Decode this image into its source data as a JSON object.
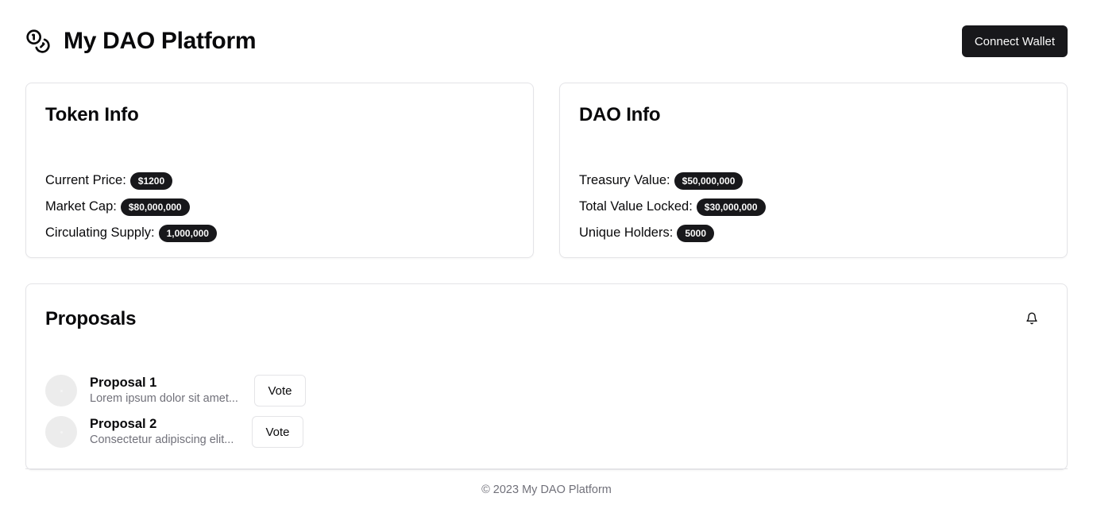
{
  "header": {
    "title": "My DAO Platform",
    "logo_icon": "coins-icon",
    "connect_label": "Connect Wallet"
  },
  "token_info": {
    "title": "Token Info",
    "stats": [
      {
        "label": "Current Price:",
        "value": "$1200"
      },
      {
        "label": "Market Cap:",
        "value": "$80,000,000"
      },
      {
        "label": "Circulating Supply:",
        "value": "1,000,000"
      }
    ]
  },
  "dao_info": {
    "title": "DAO Info",
    "stats": [
      {
        "label": "Treasury Value:",
        "value": "$50,000,000"
      },
      {
        "label": "Total Value Locked:",
        "value": "$30,000,000"
      },
      {
        "label": "Unique Holders:",
        "value": "5000"
      }
    ]
  },
  "proposals": {
    "title": "Proposals",
    "notification_icon": "bell-icon",
    "items": [
      {
        "title": "Proposal 1",
        "description": "Lorem ipsum dolor sit amet...",
        "vote_label": "Vote"
      },
      {
        "title": "Proposal 2",
        "description": "Consectetur adipiscing elit...",
        "vote_label": "Vote"
      }
    ]
  },
  "footer": {
    "text": "© 2023 My DAO Platform"
  },
  "colors": {
    "primary": "#18181b",
    "border": "#e4e4e7",
    "muted_text": "#71717a"
  }
}
